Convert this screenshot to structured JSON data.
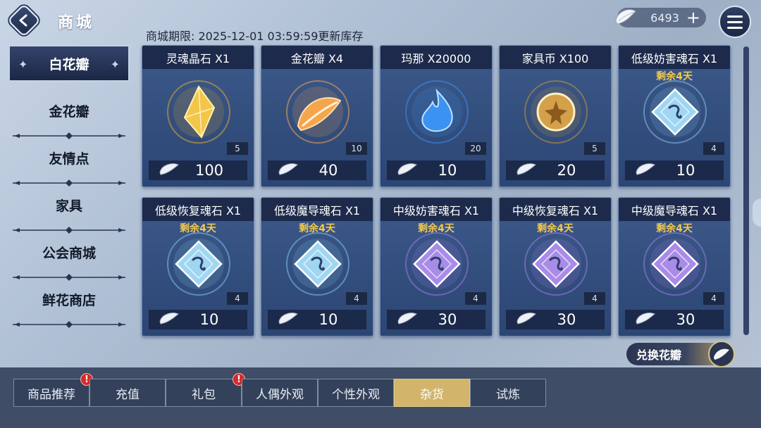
{
  "header": {
    "title": "商城",
    "deadline": "商城期限:  2025-12-01 03:59:59更新库存",
    "currency_amount": "6493",
    "currency_plus": "+"
  },
  "sidebar": {
    "items": [
      {
        "label": "白花瓣",
        "active": true
      },
      {
        "label": "金花瓣",
        "active": false
      },
      {
        "label": "友情点",
        "active": false
      },
      {
        "label": "家具",
        "active": false
      },
      {
        "label": "公会商城",
        "active": false
      },
      {
        "label": "鲜花商店",
        "active": false
      }
    ]
  },
  "items": [
    {
      "name": "灵魂晶石 X1",
      "sub": "",
      "stock": "5",
      "price": "100",
      "icon": "gold-crystal-icon",
      "color": "#e0a832"
    },
    {
      "name": "金花瓣 X4",
      "sub": "",
      "stock": "10",
      "price": "40",
      "icon": "gold-petal-icon",
      "color": "#f0a050"
    },
    {
      "name": "玛那 X20000",
      "sub": "",
      "stock": "20",
      "price": "10",
      "icon": "mana-flame-icon",
      "color": "#3a8ef0"
    },
    {
      "name": "家具币 X100",
      "sub": "",
      "stock": "5",
      "price": "20",
      "icon": "furniture-coin-icon",
      "color": "#c8923a"
    },
    {
      "name": "低级妨害魂石 X1",
      "sub": "剩余4天",
      "stock": "4",
      "price": "10",
      "icon": "blue-soulstone-icon",
      "color": "#7fc0ea"
    },
    {
      "name": "低级恢复魂石 X1",
      "sub": "剩余4天",
      "stock": "4",
      "price": "10",
      "icon": "blue-soulstone-icon",
      "color": "#7fc0ea"
    },
    {
      "name": "低级魔导魂石 X1",
      "sub": "剩余4天",
      "stock": "4",
      "price": "10",
      "icon": "blue-soulstone-icon",
      "color": "#7fc0ea"
    },
    {
      "name": "中级妨害魂石 X1",
      "sub": "剩余4天",
      "stock": "4",
      "price": "30",
      "icon": "purple-soulstone-icon",
      "color": "#9a7ae8"
    },
    {
      "name": "中级恢复魂石 X1",
      "sub": "剩余4天",
      "stock": "4",
      "price": "30",
      "icon": "purple-soulstone-icon",
      "color": "#9a7ae8"
    },
    {
      "name": "中级魔导魂石 X1",
      "sub": "剩余4天",
      "stock": "4",
      "price": "30",
      "icon": "purple-soulstone-icon",
      "color": "#9a7ae8"
    }
  ],
  "exchange_label": "兑换花瓣",
  "tabs": [
    {
      "label": "商品推荐",
      "active": false,
      "badge": "!"
    },
    {
      "label": "充值",
      "active": false,
      "badge": ""
    },
    {
      "label": "礼包",
      "active": false,
      "badge": "!"
    },
    {
      "label": "人偶外观",
      "active": false,
      "badge": ""
    },
    {
      "label": "个性外观",
      "active": false,
      "badge": ""
    },
    {
      "label": "杂货",
      "active": true,
      "badge": ""
    },
    {
      "label": "试炼",
      "active": false,
      "badge": ""
    }
  ]
}
